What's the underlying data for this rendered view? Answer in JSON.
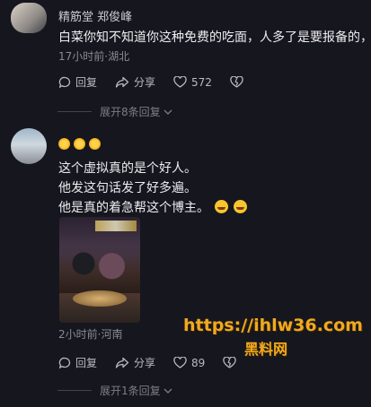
{
  "comment1": {
    "username": "精筋堂 郑俊峰",
    "text": "白菜你知不知道你这种免费的吃面，人多了是要报备的，",
    "meta": "17小时前·湖北",
    "reply_label": "回复",
    "share_label": "分享",
    "like_count": "572",
    "expand_label": "展开8条回复"
  },
  "comment2": {
    "line1": "这个虚拟真的是个好人。",
    "line2": "他发这句话发了好多遍。",
    "line3": "他是真的着急帮这个博主。",
    "meta": "2小时前·河南",
    "reply_label": "回复",
    "share_label": "分享",
    "like_count": "89",
    "expand_label": "展开1条回复"
  },
  "watermark": {
    "url": "https://ihlw36.com",
    "name": "黑料网"
  }
}
